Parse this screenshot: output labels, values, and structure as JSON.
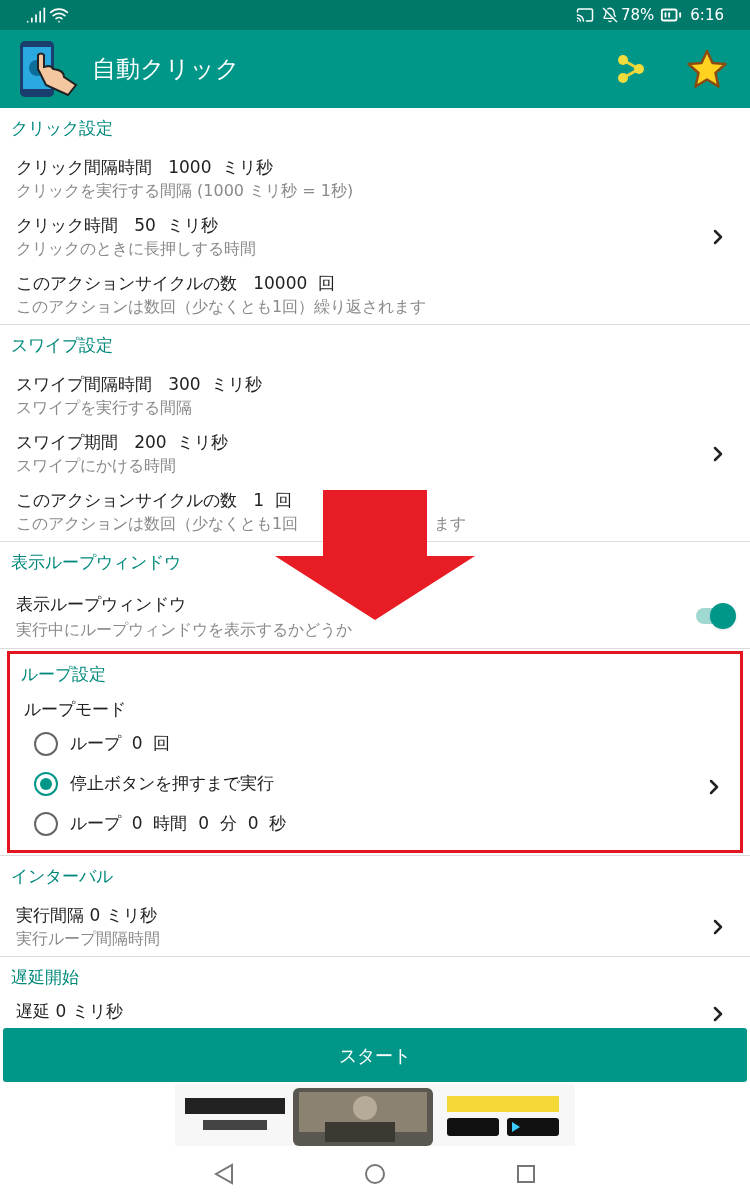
{
  "status_bar": {
    "battery": "78%",
    "time": "6:16"
  },
  "app_bar": {
    "title": "自動クリック"
  },
  "sections": [
    {
      "kind": "list",
      "title": "クリック設定",
      "highlighted": false,
      "chevron": true,
      "items": [
        {
          "title": "クリック間隔時間   1000  ミリ秒",
          "subtitle": [
            "クリックを実行する間隔 (1000 ミリ秒 = 1秒)"
          ]
        },
        {
          "title": "クリック時間   50  ミリ秒",
          "subtitle": [
            "クリックのときに長押しする時間"
          ]
        },
        {
          "title": "このアクションサイクルの数   10000  回",
          "subtitle": [
            "このアクションは数回（少なくとも1回）繰り返されます"
          ]
        }
      ]
    },
    {
      "kind": "list",
      "title": "スワイプ設定",
      "highlighted": false,
      "chevron": true,
      "items": [
        {
          "title": "スワイプ間隔時間   300  ミリ秒",
          "subtitle": [
            "スワイプを実行する間隔"
          ]
        },
        {
          "title": "スワイプ期間   200  ミリ秒",
          "subtitle": [
            "スワイプにかける時間"
          ]
        },
        {
          "title": "このアクションサイクルの数   1  回",
          "subtitle": [
            "このアクションは数回（少なくとも1回",
            "ます"
          ]
        }
      ]
    },
    {
      "kind": "toggle",
      "title": "表示ループウィンドウ",
      "highlighted": false,
      "chevron": false,
      "items": [
        {
          "title": "表示ループウィンドウ",
          "subtitle": [
            "実行中にループウィンドウを表示するかどうか"
          ],
          "on": true
        }
      ]
    },
    {
      "kind": "radio",
      "title": "ループ設定",
      "highlighted": true,
      "chevron": true,
      "label": "ループモード",
      "options": [
        {
          "label": "ループ  0  回",
          "selected": false
        },
        {
          "label": "停止ボタンを押すまで実行",
          "selected": true
        },
        {
          "label": "ループ  0  時間  0  分  0  秒",
          "selected": false
        }
      ]
    },
    {
      "kind": "list",
      "title": "インターバル",
      "highlighted": false,
      "chevron": true,
      "items": [
        {
          "title": "実行間隔 0 ミリ秒",
          "subtitle": [
            "実行ループ間隔時間"
          ]
        }
      ]
    },
    {
      "kind": "list",
      "title": "遅延開始",
      "highlighted": false,
      "chevron": true,
      "items": [
        {
          "title": "遅延 0 ミリ秒"
        }
      ]
    }
  ],
  "start_button": {
    "label": "スタート"
  }
}
